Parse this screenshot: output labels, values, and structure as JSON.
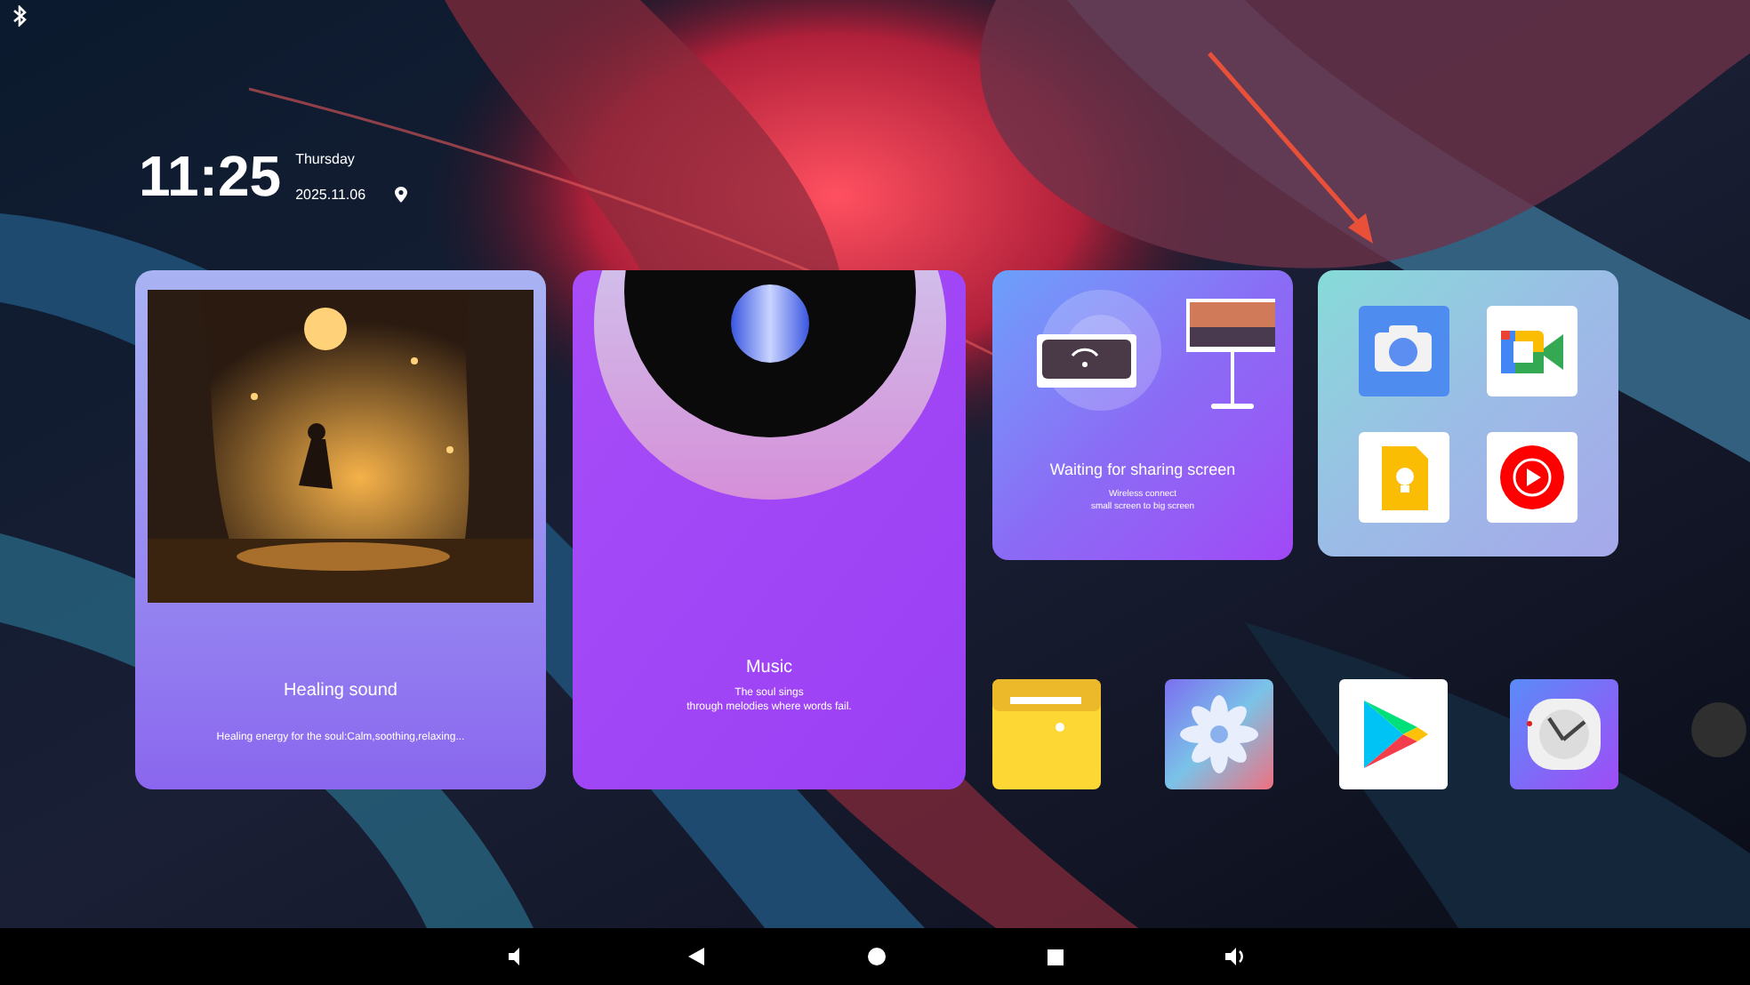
{
  "clock": {
    "time": "11:25",
    "day": "Thursday",
    "date": "2025.11.06"
  },
  "healing_card": {
    "title": "Healing sound",
    "subtitle": "Healing energy for the soul:Calm,soothing,relaxing..."
  },
  "music_card": {
    "title": "Music",
    "lines": [
      "The soul sings",
      "through melodies where words fail."
    ]
  },
  "cast_card": {
    "title": "Waiting for sharing screen",
    "lines": [
      "Wireless connect",
      "small screen to big screen"
    ]
  }
}
